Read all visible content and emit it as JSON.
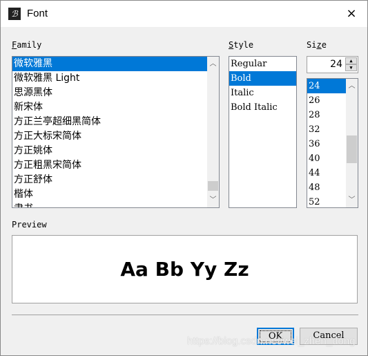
{
  "window": {
    "title": "Font",
    "close_icon": "×"
  },
  "family": {
    "label": "Family",
    "accesskey": "F",
    "items": [
      "微软雅黑",
      "微软雅黑 Light",
      "思源黑体",
      "新宋体",
      "方正兰亭超细黑简体",
      "方正大标宋简体",
      "方正姚体",
      "方正粗黑宋简体",
      "方正舒体",
      "楷体",
      "隶书"
    ],
    "selected": 0
  },
  "style": {
    "label": "Style",
    "accesskey": "S",
    "items": [
      "Regular",
      "Bold",
      "Italic",
      "Bold Italic"
    ],
    "selected": 1
  },
  "size": {
    "label": "Size",
    "accesskey": "z",
    "value": "24",
    "items": [
      "24",
      "26",
      "28",
      "32",
      "36",
      "40",
      "44",
      "48",
      "52"
    ],
    "selected": 0
  },
  "preview": {
    "label": "Preview",
    "text": "Aa Bb Yy Zz"
  },
  "buttons": {
    "ok": "OK",
    "cancel": "Cancel"
  },
  "watermark": "https://blog.csdn.net/wei_zhen_dong",
  "colors": {
    "selection": "#0078d7"
  }
}
